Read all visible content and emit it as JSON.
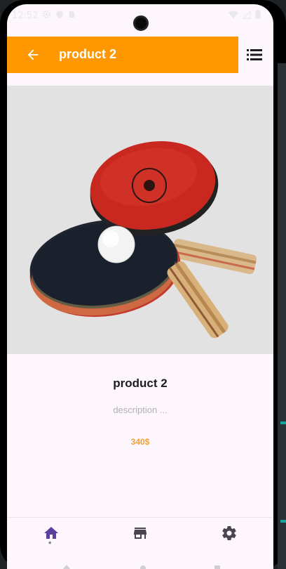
{
  "status_bar": {
    "time": "12:52",
    "icons_left": [
      "gear-icon",
      "shield-icon",
      "sim-card-icon"
    ],
    "icons_right": [
      "wifi-icon",
      "signal-icon",
      "battery-icon"
    ]
  },
  "app_bar": {
    "title": "product 2",
    "color": "#ff9800",
    "back_icon": "arrow-back-icon",
    "menu_icon": "list-icon"
  },
  "product": {
    "name": "product 2",
    "description": "description ...",
    "price": "340$",
    "image": "table-tennis-paddles-image"
  },
  "bottom_nav": {
    "items": [
      {
        "icon": "home-icon",
        "label": "*",
        "selected": true
      },
      {
        "icon": "store-icon",
        "selected": false
      },
      {
        "icon": "settings-icon",
        "selected": false
      }
    ],
    "accent": "#5b3f9e"
  }
}
